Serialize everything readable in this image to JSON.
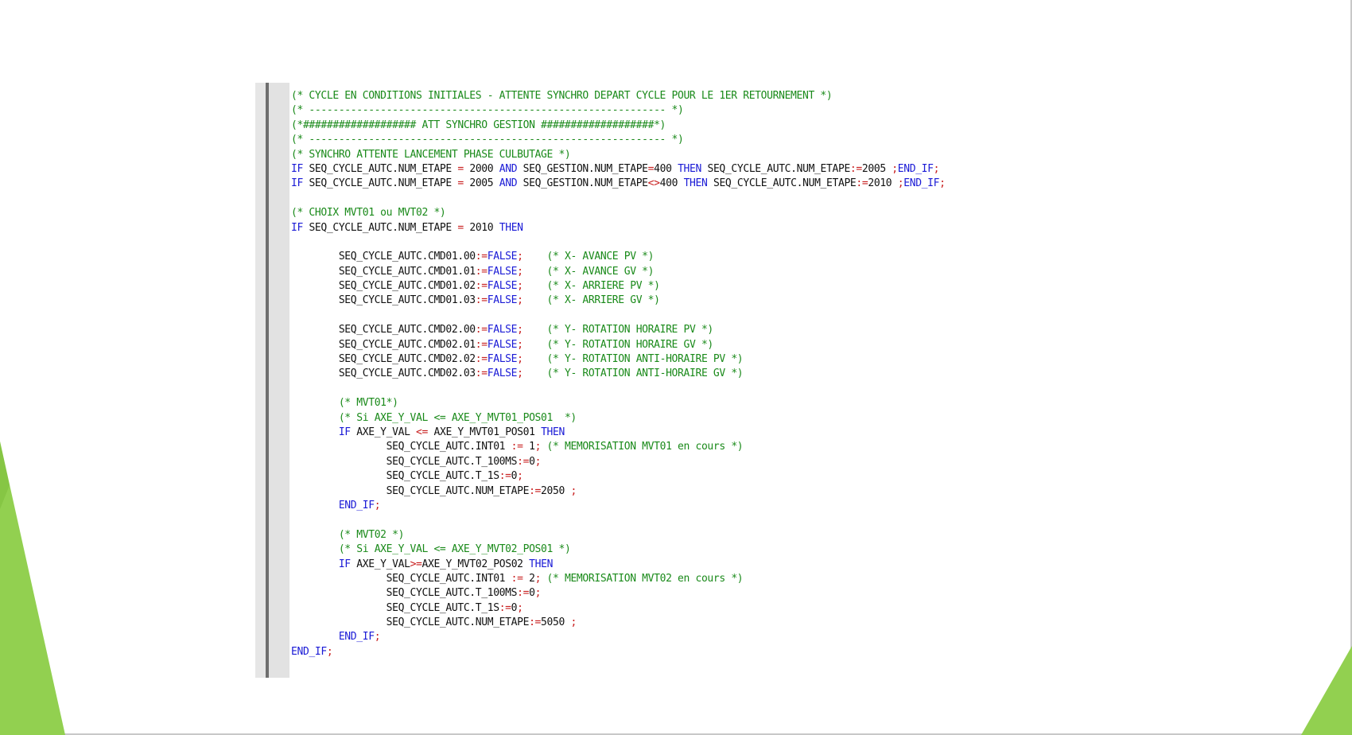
{
  "theme": {
    "accent": "#92d050",
    "accent_dark": "#5e9e1e",
    "comment": "#1a8a1a",
    "keyword": "#1a1ad6",
    "operator": "#c81e1e",
    "identifier": "#111111"
  },
  "code_editor": {
    "lines": [
      [
        {
          "t": "c",
          "v": "(* CYCLE EN CONDITIONS INITIALES - ATTENTE SYNCHRO DEPART CYCLE POUR LE 1ER RETOURNEMENT *)"
        }
      ],
      [
        {
          "t": "c",
          "v": "(* ------------------------------------------------------------ *)"
        }
      ],
      [
        {
          "t": "c",
          "v": "(*################### ATT SYNCHRO GESTION ###################*)"
        }
      ],
      [
        {
          "t": "c",
          "v": "(* ------------------------------------------------------------ *)"
        }
      ],
      [
        {
          "t": "c",
          "v": "(* SYNCHRO ATTENTE LANCEMENT PHASE CULBUTAGE *)"
        }
      ],
      [
        {
          "t": "k",
          "v": "IF"
        },
        {
          "t": "i",
          "v": " SEQ_CYCLE_AUTC.NUM_ETAPE "
        },
        {
          "t": "o",
          "v": "="
        },
        {
          "t": "i",
          "v": " 2000 "
        },
        {
          "t": "k",
          "v": "AND"
        },
        {
          "t": "i",
          "v": " SEQ_GESTION.NUM_ETAPE"
        },
        {
          "t": "o",
          "v": "="
        },
        {
          "t": "i",
          "v": "400 "
        },
        {
          "t": "k",
          "v": "THEN"
        },
        {
          "t": "i",
          "v": " SEQ_CYCLE_AUTC.NUM_ETAPE"
        },
        {
          "t": "o",
          "v": ":="
        },
        {
          "t": "i",
          "v": "2005 "
        },
        {
          "t": "o",
          "v": ";"
        },
        {
          "t": "k",
          "v": "END_IF"
        },
        {
          "t": "o",
          "v": ";"
        }
      ],
      [
        {
          "t": "k",
          "v": "IF"
        },
        {
          "t": "i",
          "v": " SEQ_CYCLE_AUTC.NUM_ETAPE "
        },
        {
          "t": "o",
          "v": "="
        },
        {
          "t": "i",
          "v": " 2005 "
        },
        {
          "t": "k",
          "v": "AND"
        },
        {
          "t": "i",
          "v": " SEQ_GESTION.NUM_ETAPE"
        },
        {
          "t": "o",
          "v": "<>"
        },
        {
          "t": "i",
          "v": "400 "
        },
        {
          "t": "k",
          "v": "THEN"
        },
        {
          "t": "i",
          "v": " SEQ_CYCLE_AUTC.NUM_ETAPE"
        },
        {
          "t": "o",
          "v": ":="
        },
        {
          "t": "i",
          "v": "2010 "
        },
        {
          "t": "o",
          "v": ";"
        },
        {
          "t": "k",
          "v": "END_IF"
        },
        {
          "t": "o",
          "v": ";"
        }
      ],
      [],
      [
        {
          "t": "c",
          "v": "(* CHOIX MVT01 ou MVT02 *)"
        }
      ],
      [
        {
          "t": "k",
          "v": "IF"
        },
        {
          "t": "i",
          "v": " SEQ_CYCLE_AUTC.NUM_ETAPE "
        },
        {
          "t": "o",
          "v": "="
        },
        {
          "t": "i",
          "v": " 2010 "
        },
        {
          "t": "k",
          "v": "THEN"
        }
      ],
      [],
      [
        {
          "t": "i",
          "v": "        SEQ_CYCLE_AUTC.CMD01.00"
        },
        {
          "t": "o",
          "v": ":="
        },
        {
          "t": "k",
          "v": "FALSE"
        },
        {
          "t": "o",
          "v": ";"
        },
        {
          "t": "i",
          "v": "    "
        },
        {
          "t": "c",
          "v": "(* X- AVANCE PV *)"
        }
      ],
      [
        {
          "t": "i",
          "v": "        SEQ_CYCLE_AUTC.CMD01.01"
        },
        {
          "t": "o",
          "v": ":="
        },
        {
          "t": "k",
          "v": "FALSE"
        },
        {
          "t": "o",
          "v": ";"
        },
        {
          "t": "i",
          "v": "    "
        },
        {
          "t": "c",
          "v": "(* X- AVANCE GV *)"
        }
      ],
      [
        {
          "t": "i",
          "v": "        SEQ_CYCLE_AUTC.CMD01.02"
        },
        {
          "t": "o",
          "v": ":="
        },
        {
          "t": "k",
          "v": "FALSE"
        },
        {
          "t": "o",
          "v": ";"
        },
        {
          "t": "i",
          "v": "    "
        },
        {
          "t": "c",
          "v": "(* X- ARRIERE PV *)"
        }
      ],
      [
        {
          "t": "i",
          "v": "        SEQ_CYCLE_AUTC.CMD01.03"
        },
        {
          "t": "o",
          "v": ":="
        },
        {
          "t": "k",
          "v": "FALSE"
        },
        {
          "t": "o",
          "v": ";"
        },
        {
          "t": "i",
          "v": "    "
        },
        {
          "t": "c",
          "v": "(* X- ARRIERE GV *)"
        }
      ],
      [],
      [
        {
          "t": "i",
          "v": "        SEQ_CYCLE_AUTC.CMD02.00"
        },
        {
          "t": "o",
          "v": ":="
        },
        {
          "t": "k",
          "v": "FALSE"
        },
        {
          "t": "o",
          "v": ";"
        },
        {
          "t": "i",
          "v": "    "
        },
        {
          "t": "c",
          "v": "(* Y- ROTATION HORAIRE PV *)"
        }
      ],
      [
        {
          "t": "i",
          "v": "        SEQ_CYCLE_AUTC.CMD02.01"
        },
        {
          "t": "o",
          "v": ":="
        },
        {
          "t": "k",
          "v": "FALSE"
        },
        {
          "t": "o",
          "v": ";"
        },
        {
          "t": "i",
          "v": "    "
        },
        {
          "t": "c",
          "v": "(* Y- ROTATION HORAIRE GV *)"
        }
      ],
      [
        {
          "t": "i",
          "v": "        SEQ_CYCLE_AUTC.CMD02.02"
        },
        {
          "t": "o",
          "v": ":="
        },
        {
          "t": "k",
          "v": "FALSE"
        },
        {
          "t": "o",
          "v": ";"
        },
        {
          "t": "i",
          "v": "    "
        },
        {
          "t": "c",
          "v": "(* Y- ROTATION ANTI-HORAIRE PV *)"
        }
      ],
      [
        {
          "t": "i",
          "v": "        SEQ_CYCLE_AUTC.CMD02.03"
        },
        {
          "t": "o",
          "v": ":="
        },
        {
          "t": "k",
          "v": "FALSE"
        },
        {
          "t": "o",
          "v": ";"
        },
        {
          "t": "i",
          "v": "    "
        },
        {
          "t": "c",
          "v": "(* Y- ROTATION ANTI-HORAIRE GV *)"
        }
      ],
      [],
      [
        {
          "t": "i",
          "v": "        "
        },
        {
          "t": "c",
          "v": "(* MVT01*)"
        }
      ],
      [
        {
          "t": "i",
          "v": "        "
        },
        {
          "t": "c",
          "v": "(* Si AXE_Y_VAL <= AXE_Y_MVT01_POS01  *)"
        }
      ],
      [
        {
          "t": "i",
          "v": "        "
        },
        {
          "t": "k",
          "v": "IF"
        },
        {
          "t": "i",
          "v": " AXE_Y_VAL "
        },
        {
          "t": "o",
          "v": "<="
        },
        {
          "t": "i",
          "v": " AXE_Y_MVT01_POS01 "
        },
        {
          "t": "k",
          "v": "THEN"
        }
      ],
      [
        {
          "t": "i",
          "v": "                SEQ_CYCLE_AUTC.INT01 "
        },
        {
          "t": "o",
          "v": ":="
        },
        {
          "t": "i",
          "v": " 1"
        },
        {
          "t": "o",
          "v": ";"
        },
        {
          "t": "i",
          "v": " "
        },
        {
          "t": "c",
          "v": "(* MEMORISATION MVT01 en cours *)"
        }
      ],
      [
        {
          "t": "i",
          "v": "                SEQ_CYCLE_AUTC.T_100MS"
        },
        {
          "t": "o",
          "v": ":="
        },
        {
          "t": "i",
          "v": "0"
        },
        {
          "t": "o",
          "v": ";"
        }
      ],
      [
        {
          "t": "i",
          "v": "                SEQ_CYCLE_AUTC.T_1S"
        },
        {
          "t": "o",
          "v": ":="
        },
        {
          "t": "i",
          "v": "0"
        },
        {
          "t": "o",
          "v": ";"
        }
      ],
      [
        {
          "t": "i",
          "v": "                SEQ_CYCLE_AUTC.NUM_ETAPE"
        },
        {
          "t": "o",
          "v": ":="
        },
        {
          "t": "i",
          "v": "2050 "
        },
        {
          "t": "o",
          "v": ";"
        }
      ],
      [
        {
          "t": "i",
          "v": "        "
        },
        {
          "t": "k",
          "v": "END_IF"
        },
        {
          "t": "o",
          "v": ";"
        }
      ],
      [],
      [
        {
          "t": "i",
          "v": "        "
        },
        {
          "t": "c",
          "v": "(* MVT02 *)"
        }
      ],
      [
        {
          "t": "i",
          "v": "        "
        },
        {
          "t": "c",
          "v": "(* Si AXE_Y_VAL <= AXE_Y_MVT02_POS01 *)"
        }
      ],
      [
        {
          "t": "i",
          "v": "        "
        },
        {
          "t": "k",
          "v": "IF"
        },
        {
          "t": "i",
          "v": " AXE_Y_VAL"
        },
        {
          "t": "o",
          "v": ">="
        },
        {
          "t": "i",
          "v": "AXE_Y_MVT02_POS02 "
        },
        {
          "t": "k",
          "v": "THEN"
        }
      ],
      [
        {
          "t": "i",
          "v": "                SEQ_CYCLE_AUTC.INT01 "
        },
        {
          "t": "o",
          "v": ":="
        },
        {
          "t": "i",
          "v": " 2"
        },
        {
          "t": "o",
          "v": ";"
        },
        {
          "t": "i",
          "v": " "
        },
        {
          "t": "c",
          "v": "(* MEMORISATION MVT02 en cours *)"
        }
      ],
      [
        {
          "t": "i",
          "v": "                SEQ_CYCLE_AUTC.T_100MS"
        },
        {
          "t": "o",
          "v": ":="
        },
        {
          "t": "i",
          "v": "0"
        },
        {
          "t": "o",
          "v": ";"
        }
      ],
      [
        {
          "t": "i",
          "v": "                SEQ_CYCLE_AUTC.T_1S"
        },
        {
          "t": "o",
          "v": ":="
        },
        {
          "t": "i",
          "v": "0"
        },
        {
          "t": "o",
          "v": ";"
        }
      ],
      [
        {
          "t": "i",
          "v": "                SEQ_CYCLE_AUTC.NUM_ETAPE"
        },
        {
          "t": "o",
          "v": ":="
        },
        {
          "t": "i",
          "v": "5050 "
        },
        {
          "t": "o",
          "v": ";"
        }
      ],
      [
        {
          "t": "i",
          "v": "        "
        },
        {
          "t": "k",
          "v": "END_IF"
        },
        {
          "t": "o",
          "v": ";"
        }
      ],
      [
        {
          "t": "k",
          "v": "END_IF"
        },
        {
          "t": "o",
          "v": ";"
        }
      ]
    ]
  }
}
